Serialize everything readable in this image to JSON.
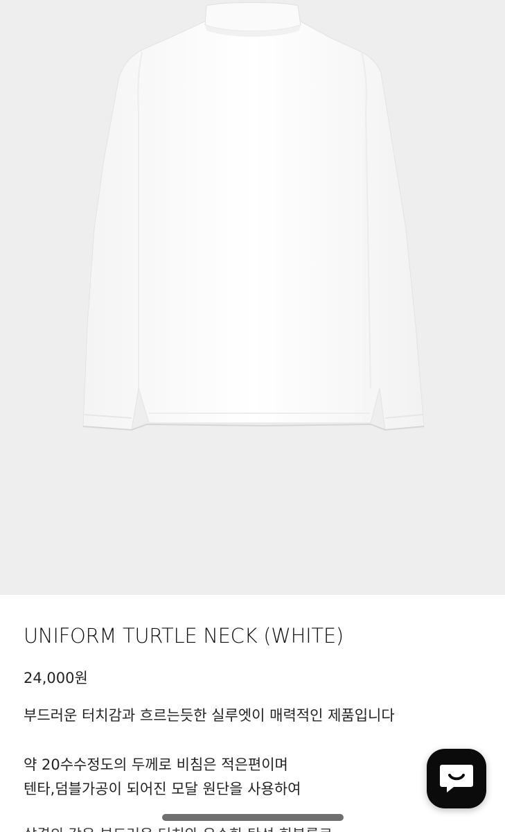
{
  "product": {
    "title": "UNIFORM TURTLE NECK (WHITE)",
    "price": "24,000원",
    "description": [
      "부드러운 터치감과 흐르는듯한 실루엣이 매력적인 제품입니다",
      "약 20수수정도의 두께로 비침은 적은편이며",
      "텐타,덤블가공이 되어진 모달 원단을 사용하여"
    ],
    "description_cut": "살결의 같은 부드러운 터치와 우수한 탄성 회복률로"
  },
  "image": {
    "icon": "turtleneck-shirt-photo",
    "bg_color": "#eeeeee"
  },
  "chat": {
    "icon": "chat-bubble-icon",
    "color": "#0b0b0b"
  }
}
